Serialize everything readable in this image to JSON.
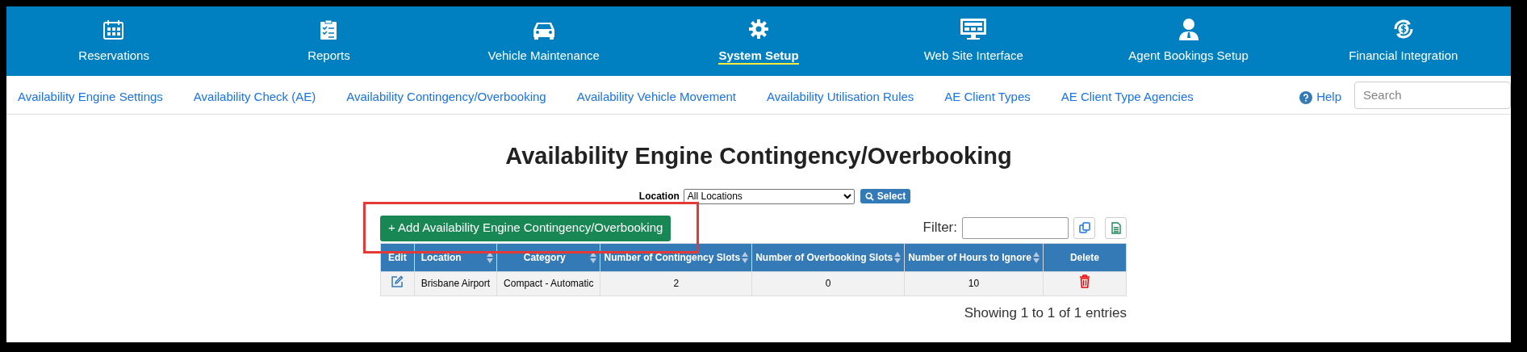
{
  "main_nav": [
    {
      "label": "Reservations",
      "selected": false
    },
    {
      "label": "Reports",
      "selected": false
    },
    {
      "label": "Vehicle Maintenance",
      "selected": false
    },
    {
      "label": "System Setup",
      "selected": true
    },
    {
      "label": "Web Site Interface",
      "selected": false
    },
    {
      "label": "Agent Bookings Setup",
      "selected": false
    },
    {
      "label": "Financial Integration",
      "selected": false
    }
  ],
  "sub_nav": [
    "Availability Engine Settings",
    "Availability Check (AE)",
    "Availability Contingency/Overbooking",
    "Availability Vehicle Movement",
    "Availability Utilisation Rules",
    "AE Client Types",
    "AE Client Type Agencies"
  ],
  "help": "Help",
  "search": {
    "placeholder": "Search"
  },
  "page_title": "Availability Engine Contingency/Overbooking",
  "location_filter": {
    "label": "Location",
    "value": "All Locations",
    "button": "Select"
  },
  "add_button": {
    "label": "+ Add Availability Engine Contingency/Overbooking",
    "highlighted": true
  },
  "filter": {
    "label": "Filter:"
  },
  "table": {
    "columns": [
      {
        "label": "Edit",
        "sortable": false
      },
      {
        "label": "Location",
        "sortable": true
      },
      {
        "label": "Category",
        "sortable": true
      },
      {
        "label": "Number of Contingency Slots",
        "sortable": true
      },
      {
        "label": "Number of Overbooking Slots",
        "sortable": true
      },
      {
        "label": "Number of Hours to Ignore",
        "sortable": true
      },
      {
        "label": "Delete",
        "sortable": false
      }
    ],
    "rows": [
      {
        "location": "Brisbane Airport",
        "category": "Compact - Automatic",
        "contingency_slots": "2",
        "overbooking_slots": "0",
        "hours_to_ignore": "10"
      }
    ]
  },
  "table_info": "Showing 1 to 1 of 1 entries"
}
